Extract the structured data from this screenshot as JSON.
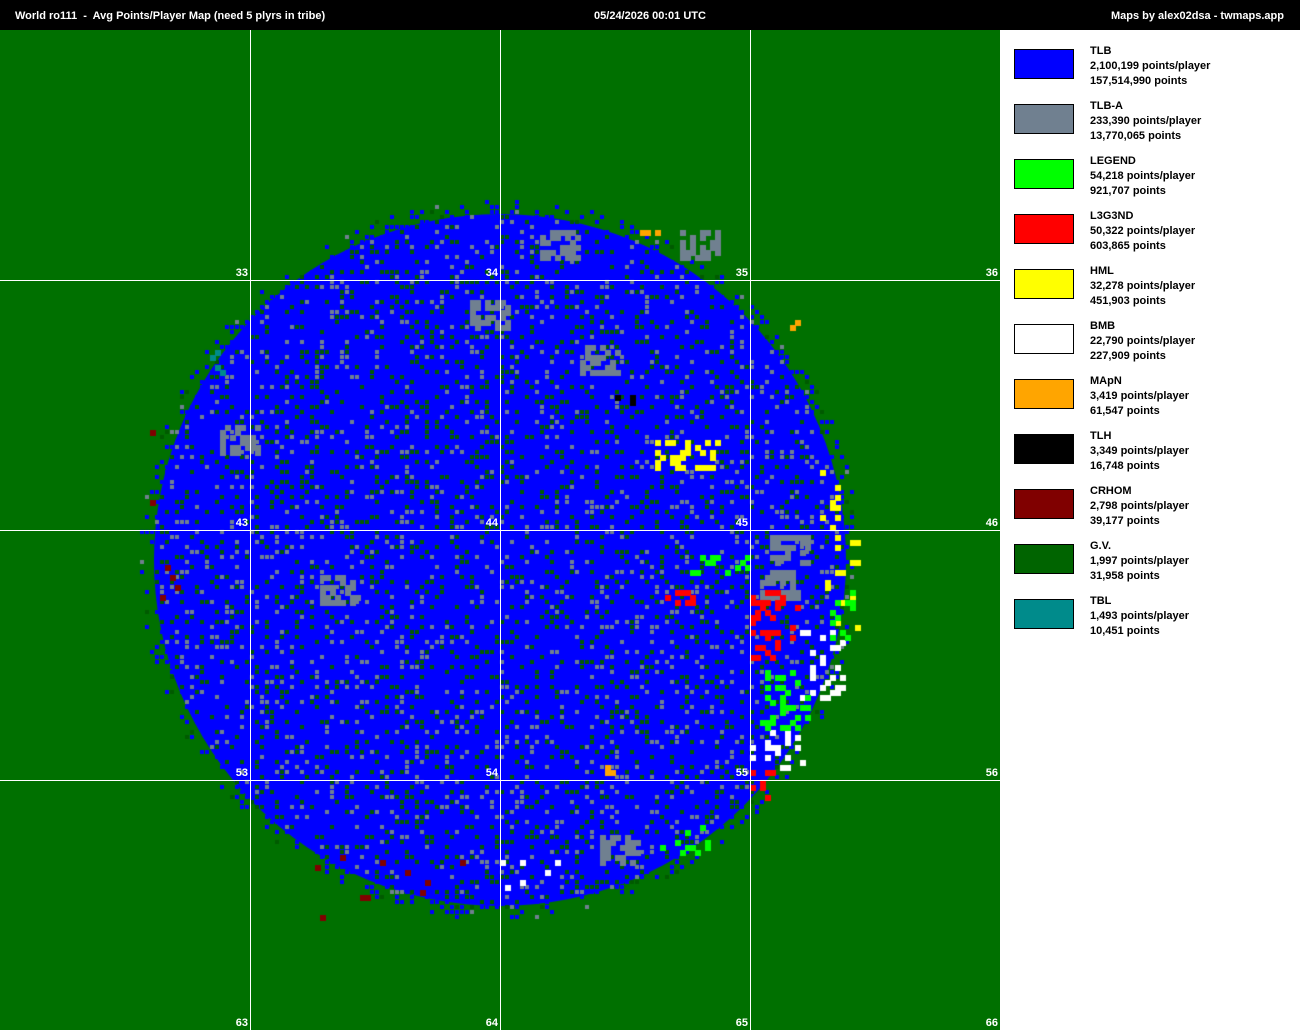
{
  "header": {
    "title": "World ro111  -  Avg Points/Player Map (need 5 plyrs in tribe)",
    "timestamp": "05/24/2026 00:01 UTC",
    "credit": "Maps by alex02dsa - twmaps.app"
  },
  "map": {
    "background_color": "#007000",
    "grid_color": "#ffffff",
    "continent_labels": [
      "33",
      "34",
      "35",
      "36",
      "43",
      "44",
      "45",
      "46",
      "53",
      "54",
      "55",
      "56",
      "63",
      "64",
      "65",
      "66"
    ],
    "village_colors": {
      "tlb": "#0000ff",
      "tlb_a": "#708090",
      "barbarian": "#005a00",
      "legend": "#00ff00",
      "l3g3nd": "#ff0000",
      "hml": "#ffff00",
      "bmb": "#ffffff",
      "mapn": "#ffa500",
      "tlh": "#000000",
      "crhom": "#800000",
      "tbl": "#008b8b"
    }
  },
  "legend": [
    {
      "name": "TLB",
      "avg": "2,100,199 points/player",
      "total": "157,514,990 points",
      "color": "#0000ff"
    },
    {
      "name": "TLB-A",
      "avg": "233,390 points/player",
      "total": "13,770,065 points",
      "color": "#708090"
    },
    {
      "name": "LEGEND",
      "avg": "54,218 points/player",
      "total": "921,707 points",
      "color": "#00ff00"
    },
    {
      "name": "L3G3ND",
      "avg": "50,322 points/player",
      "total": "603,865 points",
      "color": "#ff0000"
    },
    {
      "name": "HML",
      "avg": "32,278 points/player",
      "total": "451,903 points",
      "color": "#ffff00"
    },
    {
      "name": "BMB",
      "avg": "22,790 points/player",
      "total": "227,909 points",
      "color": "#ffffff"
    },
    {
      "name": "MApN",
      "avg": "3,419 points/player",
      "total": "61,547 points",
      "color": "#ffa500"
    },
    {
      "name": "TLH",
      "avg": "3,349 points/player",
      "total": "16,748 points",
      "color": "#000000"
    },
    {
      "name": "CRHOM",
      "avg": "2,798 points/player",
      "total": "39,177 points",
      "color": "#800000"
    },
    {
      "name": "G.V.",
      "avg": "1,997 points/player",
      "total": "31,958 points",
      "color": "#006400"
    },
    {
      "name": "TBL",
      "avg": "1,493 points/player",
      "total": "10,451 points",
      "color": "#008b8b"
    }
  ]
}
